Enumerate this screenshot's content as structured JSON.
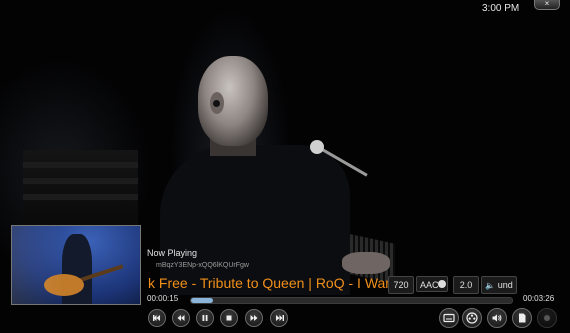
{
  "top_bar": {
    "clock": "3:00 PM",
    "close_glyph": "×"
  },
  "now_playing": {
    "heading": "Now Playing",
    "file_id": "mBqzY3ENp-xQQ6lKQUrFgw",
    "title_visible": "k Free - Tribute to Queen | RoQ - I Want"
  },
  "badges": {
    "resolution": "720",
    "audio_codec": "AAC",
    "channels": "2.0",
    "language": "und"
  },
  "timeline": {
    "elapsed": "00:00:15",
    "total": "00:03:26",
    "progress_fraction": 0.07
  },
  "controls": {
    "transport_icons": [
      "skip-previous-icon",
      "rewind-icon",
      "pause-icon",
      "stop-icon",
      "fast-forward-icon",
      "skip-next-icon"
    ],
    "right_icons": [
      "subtitles-icon",
      "video-settings-icon",
      "audio-settings-icon",
      "document-icon",
      "record-icon"
    ]
  },
  "colors": {
    "title_accent": "#f08f1a",
    "seek_fill": "#8ab4d8"
  }
}
